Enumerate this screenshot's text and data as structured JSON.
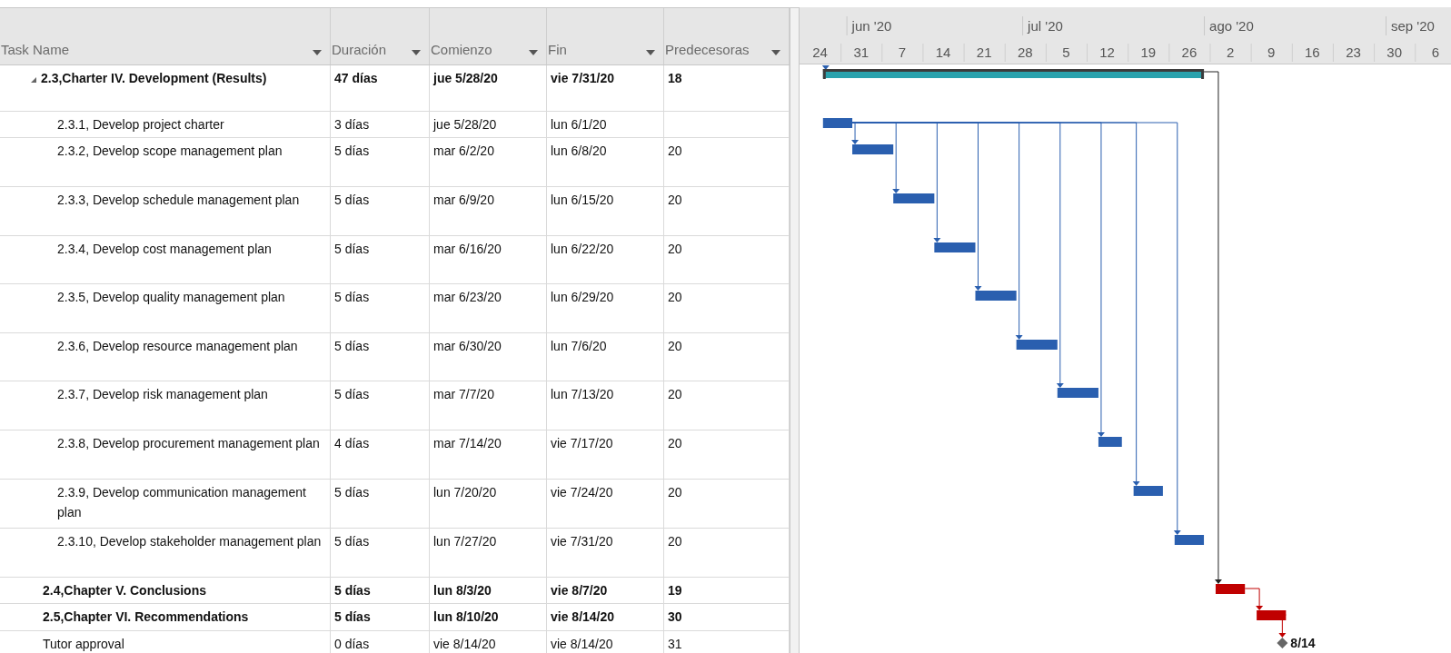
{
  "columns": [
    "Task Name",
    "Duración",
    "Comienzo",
    "Fin",
    "Predecesoras"
  ],
  "timescale": {
    "months": [
      "jun '20",
      "jul '20",
      "ago '20",
      "sep '20"
    ],
    "weeks": [
      "24",
      "31",
      "7",
      "14",
      "21",
      "28",
      "5",
      "12",
      "19",
      "26",
      "2",
      "9",
      "16",
      "23",
      "30",
      "6"
    ]
  },
  "rows": [
    {
      "name": "2.3,Charter IV. Development (Results)",
      "duration": "47 días",
      "start": "jue 5/28/20",
      "finish": "vie 7/31/20",
      "predecessors": "18",
      "bold": true,
      "kind": "summary",
      "expanded": true,
      "children": [
        {
          "name": "2.3.1, Develop project charter",
          "duration": "3 días",
          "start": "jue 5/28/20",
          "finish": "lun 6/1/20",
          "bold": false,
          "kind": "task"
        },
        {
          "name": "2.3.2, Develop scope management plan",
          "duration": "5 días",
          "start": "mar 6/2/20",
          "finish": "lun 6/8/20",
          "predecessors": "20",
          "bold": false,
          "kind": "task"
        },
        {
          "name": "2.3.3, Develop schedule management plan",
          "duration": "5 días",
          "start": "mar 6/9/20",
          "finish": "lun 6/15/20",
          "predecessors": "20",
          "bold": false,
          "kind": "task"
        },
        {
          "name": "2.3.4, Develop cost management plan",
          "duration": "5 días",
          "start": "mar 6/16/20",
          "finish": "lun 6/22/20",
          "predecessors": "20",
          "bold": false,
          "kind": "task"
        },
        {
          "name": "2.3.5, Develop quality management plan",
          "duration": "5 días",
          "start": "mar 6/23/20",
          "finish": "lun 6/29/20",
          "predecessors": "20",
          "bold": false,
          "kind": "task"
        },
        {
          "name": "2.3.6, Develop resource management plan",
          "duration": "5 días",
          "start": "mar 6/30/20",
          "finish": "lun 7/6/20",
          "predecessors": "20",
          "bold": false,
          "kind": "task"
        },
        {
          "name": "2.3.7, Develop risk management plan",
          "duration": "5 días",
          "start": "mar 7/7/20",
          "finish": "lun 7/13/20",
          "predecessors": "20",
          "bold": false,
          "kind": "task"
        },
        {
          "name": "2.3.8, Develop procurement management plan",
          "duration": "4 días",
          "start": "mar 7/14/20",
          "finish": "vie 7/17/20",
          "predecessors": "20",
          "bold": false,
          "kind": "task"
        },
        {
          "name": "2.3.9, Develop communication management plan",
          "duration": "5 días",
          "start": "lun 7/20/20",
          "finish": "vie 7/24/20",
          "predecessors": "20",
          "bold": false,
          "kind": "task"
        },
        {
          "name": "2.3.10, Develop stakeholder management plan",
          "duration": "5 días",
          "start": "lun 7/27/20",
          "finish": "vie 7/31/20",
          "predecessors": "20",
          "bold": false,
          "kind": "task"
        }
      ]
    },
    {
      "name": "2.4,Chapter V. Conclusions",
      "duration": "5 días",
      "start": "lun 8/3/20",
      "finish": "vie 8/7/20",
      "predecessors": "19",
      "bold": true,
      "kind": "critical"
    },
    {
      "name": "2.5,Chapter VI. Recommendations",
      "duration": "5 días",
      "start": "lun 8/10/20",
      "finish": "vie 8/14/20",
      "predecessors": "30",
      "bold": true,
      "kind": "critical"
    },
    {
      "name": "Tutor approval",
      "duration": "0 días",
      "start": "vie 8/14/20",
      "finish": "vie 8/14/20",
      "predecessors": "31",
      "bold": false,
      "kind": "milestone",
      "bar_label": "8/14"
    }
  ]
}
